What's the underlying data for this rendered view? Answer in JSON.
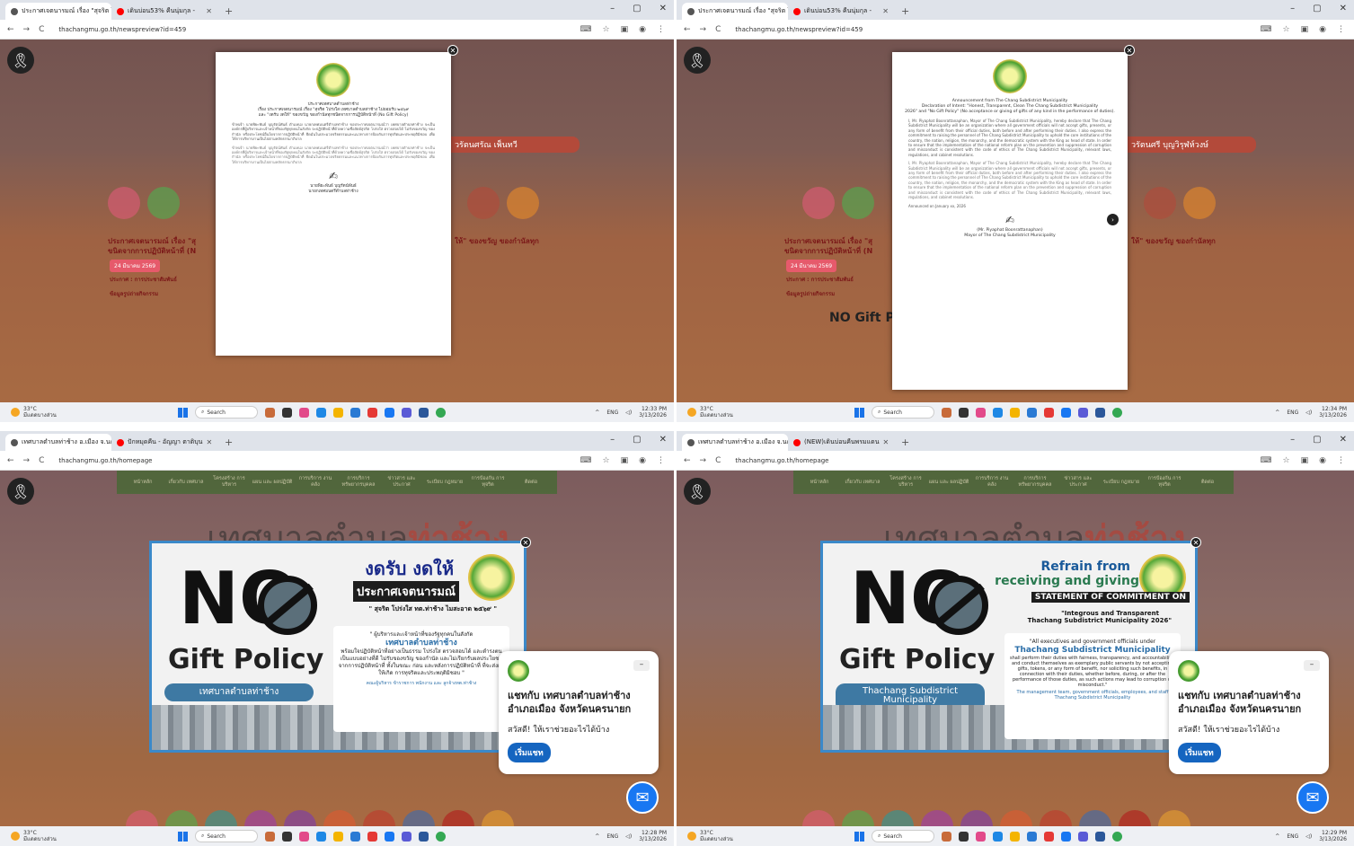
{
  "browser": {
    "tab_favicon_colors": [
      "#555555",
      "#ff0000"
    ],
    "window_controls": [
      "–",
      "▢",
      "✕"
    ],
    "new_tab_symbol": "+"
  },
  "q1": {
    "tabs": [
      {
        "label": "ประกาศเจตนารมณ์ เรื่อง \"สุจริต โปร่ง",
        "close": "✕"
      },
      {
        "label": "เดินบ่อน53% คืนนุ่มกุล - ",
        "close": "✕"
      }
    ],
    "url": "thachangmu.go.th/newspreview?id=459",
    "doc": {
      "header_lines": [
        "ประกาศเทศบาลตำบลท่าช้าง",
        "เรื่อง ประกาศเจตนารมณ์ เรื่อง \"สุจริต โปร่งใส เทศบาลตำบลท่าช้าง ไม่ยอมรับ ๒๕๖๙",
        "และ \"งดรับ งดให้\" ของขวัญ ของกำนัลทุกชนิดจากการปฏิบัติหน้าที่ (No Gift Policy)"
      ],
      "body": "ข้าพเจ้า นายพิยะพันธ์ บุญรัตน์พันธ์ ตำแหน่ง นายกเทศมนตรีตำบลท่าช้าง ขอประกาศเจตนารมณ์ว่า เทศบาลตำบลท่าช้าง จะเป็นองค์กรที่ผู้บริหารและเจ้าหน้าที่ของรัฐทุกคนในสังกัด จะปฏิบัติหน้าที่ด้วยความซื่อสัตย์สุจริต โปร่งใส ตรวจสอบได้ ไม่รับของขวัญ ของกำนัล หรือประโยชน์อื่นใดจากการปฏิบัติหน้าที่ ยึดมั่นในประมวลจริยธรรมและแนวทางการป้องกันการทุจริตและประพฤติมิชอบ เพื่อให้การบริหารงานเป็นไปตามหลักธรรมาภิบาล",
      "sign_name": "นายพิยะพันธ์ บุญรัตน์พันธ์",
      "sign_title": "นายกเทศมนตรีตำบลท่าช้าง"
    },
    "bg_texts": {
      "side_banner": "วรัตนศรัณ เพ็นทวี",
      "date_pill": "24 มีนาคม 2569",
      "heading_left": "ประกาศเจตนารมณ์ เรื่อง \"สุ",
      "heading_left2": "ขนิดจากการปฏิบัติหน้าที่ (N",
      "heading_right": "ให้\" ของขวัญ ของกำนัลทุก",
      "meta": "ประกาศ : การประชาสัมพันธ์",
      "meta2": "ข้อมูลรูปถ่ายกิจกรรม"
    },
    "taskbar": {
      "temp": "33°C",
      "weather": "มีแดดบางส่วน",
      "search": "Search",
      "lang": "ENG",
      "time": "12:33 PM",
      "date": "3/13/2026"
    }
  },
  "q2": {
    "tabs": [
      {
        "label": "ประกาศเจตนารมณ์ เรื่อง \"สุจริต โปร่ง",
        "close": "✕"
      },
      {
        "label": "เดินบ่อน53% คืนนุ่มกุล - ",
        "close": "✕"
      }
    ],
    "url": "thachangmu.go.th/newspreview?id=459",
    "doc": {
      "header_lines": [
        "Announcement from The Chang Subdistrict Municipality",
        "Declaration of Intent: \"Honest, Transparent, Clean The Chang Subdistrict Municipality",
        "2026\" and \"No Gift Policy\" (No acceptance or giving of gifts of any kind in the performance of duties)."
      ],
      "body": "I, Mr. Piyaphat Boonrattanaphan, Mayor of The Chang Subdistrict Municipality, hereby declare that The Chang Subdistrict Municipality will be an organization where all government officials will not accept gifts, presents, or any form of benefit from their official duties, both before and after performing their duties. I also express the commitment to raising the personnel of The Chang Subdistrict Municipality to uphold the core institutions of the country, the nation, religion, the monarchy, and the democratic system with the King as head of state. In order to ensure that the implementation of the national reform plan on the prevention and suppression of corruption and misconduct is consistent with the code of ethics of The Chang Subdistrict Municipality, relevant laws, regulations, and cabinet resolutions.",
      "footer": "Announced on January xx, 2026",
      "sign_name": "(Mr. Piyaphat Boonrattanaphan)",
      "sign_title": "Mayor of The Chang Subdistrict Municipality"
    },
    "bg_texts": {
      "side_banner": "วรัตนศรี บุญวิรุฬห์วงษ์",
      "date_pill": "24 มีนาคม 2569",
      "heading_left": "ประกาศเจตนารมณ์ เรื่อง \"สุ",
      "heading_left2": "ขนิดจากการปฏิบัติหน้าที่ (N",
      "heading_right": "ให้\" ของขวัญ ของกำนัลทุก",
      "meta": "ประกาศ : การประชาสัมพันธ์",
      "meta2": "ข้อมูลรูปถ่ายกิจกรรม",
      "nogift_small": "NO Gift Policy"
    },
    "taskbar": {
      "temp": "33°C",
      "weather": "มีแดดบางส่วน",
      "search": "Search",
      "lang": "ENG",
      "time": "12:34 PM",
      "date": "3/13/2026"
    }
  },
  "q3": {
    "tabs": [
      {
        "label": "เทศบาลตำบลท่าช้าง อ.เมือง จ.นครนา",
        "close": "✕"
      },
      {
        "label": "ปักหมุดคืน - อัญญา ตาติบุน",
        "close": "✕"
      }
    ],
    "url": "thachangmu.go.th/homepage",
    "nav": [
      "หน้าหลัก",
      "เกี่ยวกับ เทศบาล",
      "โครงสร้าง การบริหาร",
      "แผน และ ผลปฏิบัติ",
      "การบริการ งานคลัง",
      "การบริการ ทรัพยากรบุคคล",
      "ข่าวสาร และ ประกาศ",
      "ระเบียบ กฎหมาย",
      "การป้องกัน การทุจริต",
      "ติดต่อ"
    ],
    "site_title_a": "เทศบาลตำบล",
    "site_title_b": "ท่าช้าง",
    "banner": {
      "no": "NO",
      "gift_policy": "Gift Policy",
      "sub": "เทศบาลตำบลท่าช้าง",
      "title1": "งดรับ งดให้",
      "title2": "ประกาศเจตนารมณ์",
      "quote_head": "\" สุจริต โปร่งใส ทต.ท่าช้าง ไมสะอาด ๒๕๖๙ \"",
      "quote_intro": "\" ผู้บริหารและเจ้าหน้าที่ของรัฐทุกคนในสังกัด",
      "quote_hl": "เทศบาลตำบลท่าช้าง",
      "quote_body": "พร้อมใจปฏิบัติหน้าที่อย่างเป็นธรรม โปร่งใส ตรวจสอบได้ และดำรงตนเป็นแบบอย่างที่ดี ไม่รับของขวัญ ของกำนัล และไม่เรียกรับผลประโยชน์จากการปฏิบัติหน้าที่ ทั้งในขณะ ก่อน และหลังการปฏิบัติหน้าที่ ที่จะส่งผลให้เกิด การทุจริตและประพฤติมิชอบ \"",
      "quote_sign": "คณะผู้บริหาร ข้าราชการ พนักงาน และ ลูกจ้างทต.ท่าช้าง"
    },
    "chat": {
      "name": "แชทกับ เทศบาลตำบลท่าช้าง อำเภอเมือง จังหวัดนครนายก",
      "greeting": "สวัสดี! ให้เราช่วยอะไรได้บ้าง",
      "start": "เริ่มแชท",
      "minimize": "–"
    },
    "taskbar": {
      "temp": "33°C",
      "weather": "มีแดดบางส่วน",
      "search": "Search",
      "lang": "ENG",
      "time": "12:28 PM",
      "date": "3/13/2026"
    }
  },
  "q4": {
    "tabs": [
      {
        "label": "เทศบาลตำบลท่าช้าง อ.เมือง จ.นครนา",
        "close": "✕"
      },
      {
        "label": "(NEW)เดินบ่อนคืนพรมแดน",
        "close": "✕"
      }
    ],
    "url": "thachangmu.go.th/homepage",
    "nav": [
      "หน้าหลัก",
      "เกี่ยวกับ เทศบาล",
      "โครงสร้าง การบริหาร",
      "แผน และ ผลปฏิบัติ",
      "การบริการ งานคลัง",
      "การบริการ ทรัพยากรบุคคล",
      "ข่าวสาร และ ประกาศ",
      "ระเบียบ กฎหมาย",
      "การป้องกัน การทุจริต",
      "ติดต่อ"
    ],
    "site_title_a": "เทศบาลตำบล",
    "site_title_b": "ท่าช้าง",
    "banner": {
      "no": "NO",
      "gift_policy": "Gift Policy",
      "sub": "Thachang Subdistrict Municipality",
      "title1": "Refrain from",
      "title2": "receiving and giving",
      "commit": "STATEMENT OF COMMITMENT ON",
      "integ": "\"Integrous and Transparent",
      "integ2": "Thachang Subdistrict Municipality 2026\"",
      "quote_intro": "\"All executives and government officials under",
      "quote_hl": "Thachang Subdistrict Municipality",
      "quote_body": "shall perform their duties with fairness, transparency, and accountability, and conduct themselves as exemplary public servants by not accepting gifts, tokens, or any form of benefit, nor soliciting such benefits, in connection with their duties, whether before, during, or after the performance of those duties, as such actions may lead to corruption or misconduct.\"",
      "quote_sign": "The management team, government officials, employees, and staff Thachang Subdistrict Municipality"
    },
    "chat": {
      "name": "แชทกับ เทศบาลตำบลท่าช้าง อำเภอเมือง จังหวัดนครนายก",
      "greeting": "สวัสดี! ให้เราช่วยอะไรได้บ้าง",
      "start": "เริ่มแชท",
      "minimize": "–"
    },
    "taskbar": {
      "temp": "33°C",
      "weather": "มีแดดบางส่วน",
      "search": "Search",
      "lang": "ENG",
      "time": "12:29 PM",
      "date": "3/13/2026"
    }
  },
  "icons": {
    "back": "←",
    "forward": "→",
    "reload": "C",
    "ribbon": "🎗",
    "close": "✕",
    "next": "›",
    "messenger": "✉"
  }
}
